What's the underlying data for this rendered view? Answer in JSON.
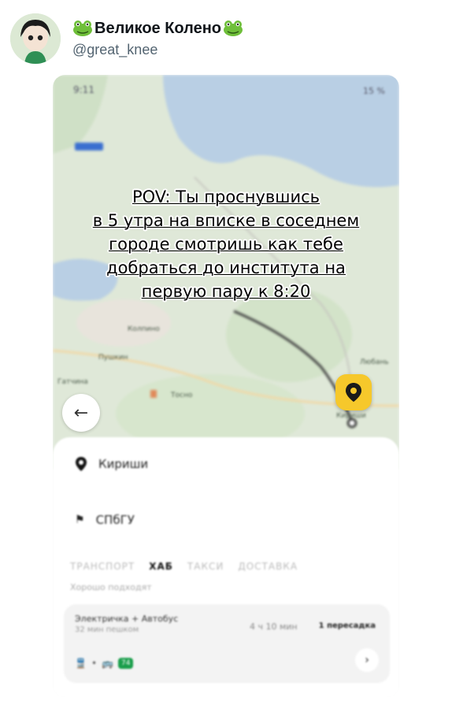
{
  "tweet": {
    "author_name": "Великое Колено",
    "handle": "@great_knee"
  },
  "media": {
    "status_time": "9:11",
    "status_battery": "15 %",
    "overlay_lines": [
      "POV: Ты проснувшись",
      "в 5 утра на вписке в соседнем",
      "городе смотришь как тебе",
      "добраться до института на",
      "первую пару к 8:20"
    ],
    "map_labels": [
      "Кириши",
      "Пушкин",
      "Колпино",
      "Гатчина",
      "Тосно",
      "Любань"
    ],
    "route_from": "Кириши",
    "route_to": "СПбГУ",
    "tabs": [
      "ТРАНСПОРТ",
      "ХАБ",
      "ТАКСИ",
      "ДОСТАВКА"
    ],
    "active_tab": "ХАБ",
    "hint": "Хорошо подходят",
    "option": {
      "title": "Электричка + Автобус",
      "subtitle": "32 мин пешком",
      "duration": "4 ч 10 мин",
      "transfers": "1 пересадка",
      "badge": "74"
    }
  }
}
